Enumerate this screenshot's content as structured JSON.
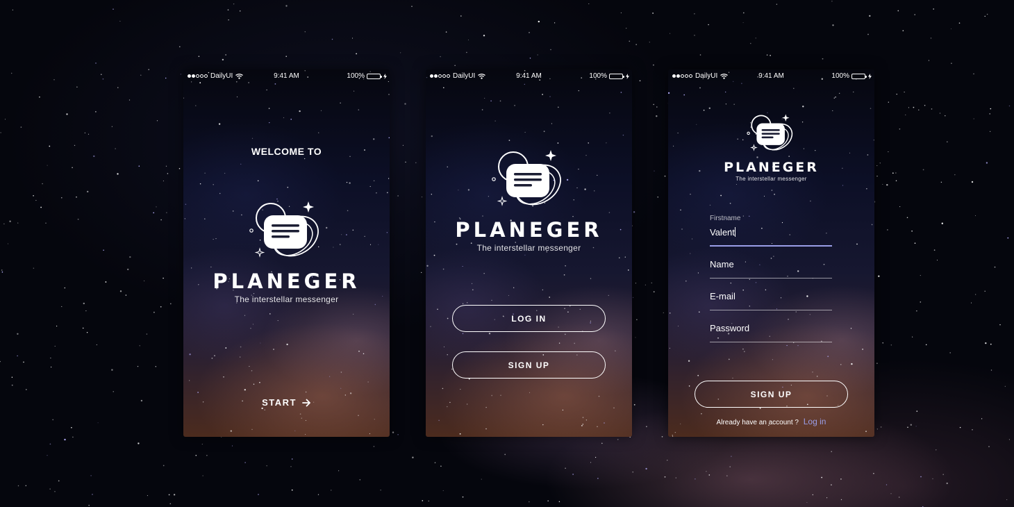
{
  "status_bar": {
    "carrier": "DailyUI",
    "time": "9:41 AM",
    "battery": "100%"
  },
  "brand": {
    "name": "PLANEGER",
    "tagline": "The interstellar messenger"
  },
  "welcome": {
    "title": "WELCOME TO",
    "start_label": "START"
  },
  "login": {
    "login_label": "LOG IN",
    "signup_label": "SIGN UP"
  },
  "signup": {
    "fields": [
      {
        "label": "Firstname",
        "value": "Valent"
      },
      {
        "placeholder": "Name"
      },
      {
        "placeholder": "E-mail"
      },
      {
        "placeholder": "Password"
      }
    ],
    "submit_label": "SIGN UP",
    "account_prompt": "Already have an account ?",
    "login_link": "Log in"
  },
  "colors": {
    "accent": "#9a9ee8",
    "battery": "#4cd964",
    "background": "#05060d"
  }
}
